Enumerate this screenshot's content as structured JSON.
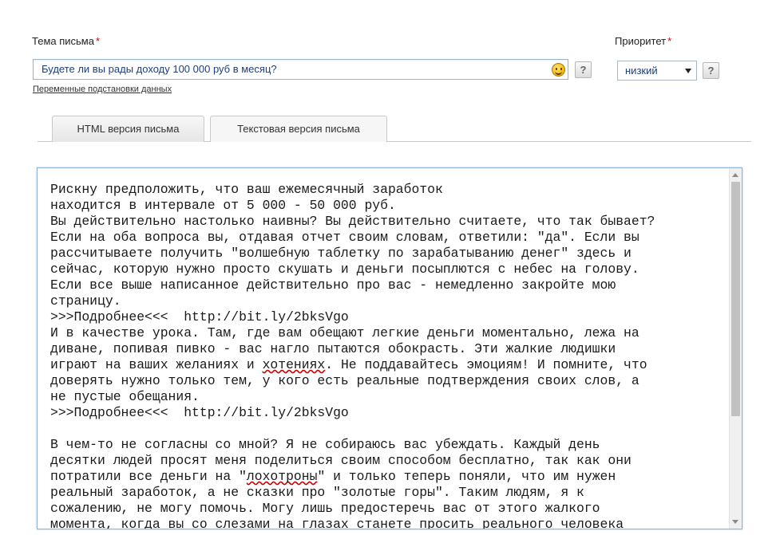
{
  "subject": {
    "label": "Тема письма",
    "required_mark": "*",
    "value": "Будете ли вы рады доходу 100 000 руб в месяц?",
    "emoji_icon": "smiley-icon",
    "help_label": "?",
    "vars_link": "Переменные подстановки данных"
  },
  "priority": {
    "label": "Приоритет",
    "required_mark": "*",
    "selected": "низкий",
    "help_label": "?"
  },
  "tabs": [
    {
      "label": "HTML версия письма",
      "active": false
    },
    {
      "label": "Текстовая версия письма",
      "active": true
    }
  ],
  "editor": {
    "lines": [
      "Рискну предположить, что ваш ежемесячный заработок",
      "находится в интервале от 5 000 - 50 000 руб.",
      "Вы действительно настолько наивны? Вы действительно считаете, что так бывает?",
      "Если на оба вопроса вы, отдавая отчет своим словам, ответили: \"да\". Если вы",
      "рассчитываете получить \"волшебную таблетку по зарабатыванию денег\" здесь и",
      "сейчас, которую нужно просто скушать и деньги посыплются с небес на голову.",
      "Если все выше написанное действительно про вас - немедленно закройте мою",
      "страницу.",
      ">>>Подробнее<<<  http://bit.ly/2bksVgo",
      "И в качестве урока. Там, где вам обещают легкие деньги моментально, лежа на",
      "диване, попивая пивко - вас нагло пытаются обокрасть. Эти жалкие людишки",
      "играют на ваших желаниях и хотениях. Не поддавайтесь эмоциям! И помните, что",
      "доверять нужно только тем, у кого есть реальные подтверждения своих слов, а",
      "не пустые обещания.",
      ">>>Подробнее<<<  http://bit.ly/2bksVgo",
      "",
      "В чем-то не согласны со мной? Я не собираюсь вас убеждать. Каждый день",
      "десятки людей просят меня поделиться своим способом бесплатно, так как они",
      "потратили все деньги на \"лохотроны\" и только теперь поняли, что им нужен",
      "реальный заработок, а не сказки про \"золотые горы\". Таким людям, я к",
      "сожалению, не могу помочь. Могу лишь предостеречь вас от этого жалкого",
      "момента, когда вы со слезами на глазах станете просить реального человека"
    ],
    "misspelled_words": [
      "хотениях",
      "лохотроны"
    ]
  }
}
